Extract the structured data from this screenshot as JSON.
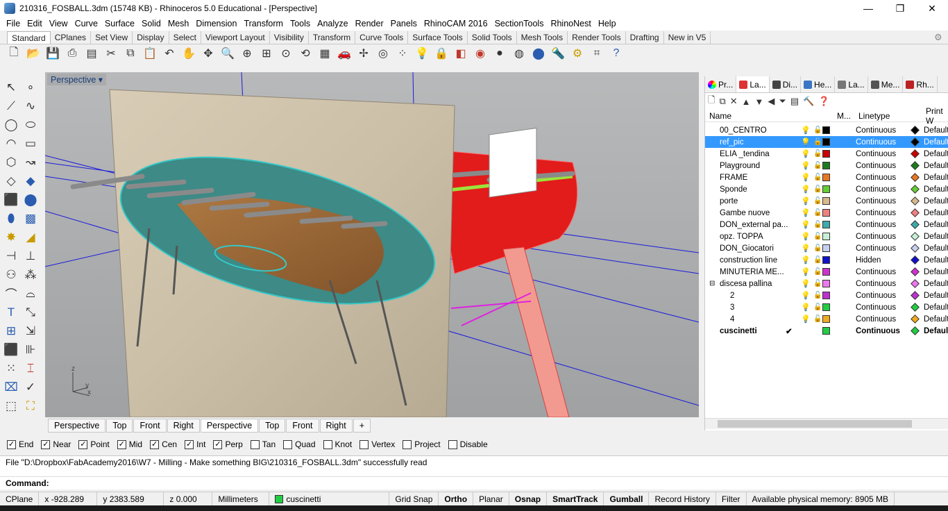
{
  "window": {
    "title": "210316_FOSBALL.3dm (15748 KB) - Rhinoceros 5.0 Educational - [Perspective]"
  },
  "menu": [
    "File",
    "Edit",
    "View",
    "Curve",
    "Surface",
    "Solid",
    "Mesh",
    "Dimension",
    "Transform",
    "Tools",
    "Analyze",
    "Render",
    "Panels",
    "RhinoCAM 2016",
    "SectionTools",
    "RhinoNest",
    "Help"
  ],
  "toolbar_tabs": [
    "Standard",
    "CPlanes",
    "Set View",
    "Display",
    "Select",
    "Viewport Layout",
    "Visibility",
    "Transform",
    "Curve Tools",
    "Surface Tools",
    "Solid Tools",
    "Mesh Tools",
    "Render Tools",
    "Drafting",
    "New in V5"
  ],
  "viewport": {
    "label": "Perspective",
    "axes": {
      "x": "x",
      "y": "y",
      "z": "z"
    }
  },
  "viewport_tabs": [
    "Perspective",
    "Top",
    "Front",
    "Right",
    "Perspective",
    "Top",
    "Front",
    "Right"
  ],
  "osnaps": [
    {
      "label": "End",
      "checked": true
    },
    {
      "label": "Near",
      "checked": true
    },
    {
      "label": "Point",
      "checked": true
    },
    {
      "label": "Mid",
      "checked": true
    },
    {
      "label": "Cen",
      "checked": true
    },
    {
      "label": "Int",
      "checked": true
    },
    {
      "label": "Perp",
      "checked": true
    },
    {
      "label": "Tan",
      "checked": false
    },
    {
      "label": "Quad",
      "checked": false
    },
    {
      "label": "Knot",
      "checked": false
    },
    {
      "label": "Vertex",
      "checked": false
    },
    {
      "label": "Project",
      "checked": false
    },
    {
      "label": "Disable",
      "checked": false
    }
  ],
  "command": {
    "history": "File \"D:\\Dropbox\\FabAcademy2016\\W7 - Milling - Make something BIG\\210316_FOSBALL.3dm\" successfully read",
    "prompt": "Command:"
  },
  "status": {
    "cplane": "CPlane",
    "x": "x -928.289",
    "y": "y 2383.589",
    "z": "z 0.000",
    "units": "Millimeters",
    "layer": "cuscinetti",
    "toggles": [
      "Grid Snap",
      "Ortho",
      "Planar",
      "Osnap",
      "SmartTrack",
      "Gumball",
      "Record History",
      "Filter"
    ],
    "bold_toggles": [
      "Ortho",
      "Osnap",
      "SmartTrack",
      "Gumball"
    ],
    "memory": "Available physical memory: 8905 MB"
  },
  "panel": {
    "tabs": [
      "Pr...",
      "La...",
      "Di...",
      "He...",
      "La...",
      "Me...",
      "Rh..."
    ],
    "columns": [
      "Name",
      "M...",
      "Linetype",
      "Print W"
    ],
    "layers": [
      {
        "name": "00_CENTRO",
        "color": "#000000",
        "linetype": "Continuous",
        "print": "Default"
      },
      {
        "name": "ref_pic",
        "color": "#000000",
        "linetype": "Continuous",
        "print": "Default",
        "selected": true
      },
      {
        "name": "ELIA _tendina",
        "color": "#cc0000",
        "linetype": "Continuous",
        "print": "Default"
      },
      {
        "name": "Playground",
        "color": "#1e7a1e",
        "linetype": "Continuous",
        "print": "Default"
      },
      {
        "name": "FRAME",
        "color": "#e87722",
        "linetype": "Continuous",
        "print": "Default"
      },
      {
        "name": "Sponde",
        "color": "#66cc33",
        "linetype": "Continuous",
        "print": "Default"
      },
      {
        "name": "porte",
        "color": "#d9b98c",
        "linetype": "Continuous",
        "print": "Default"
      },
      {
        "name": "Gambe nuove",
        "color": "#f08080",
        "linetype": "Continuous",
        "print": "Default"
      },
      {
        "name": "DON_external pa...",
        "color": "#3fa9a9",
        "linetype": "Continuous",
        "print": "Default"
      },
      {
        "name": "opz. TOPPA",
        "color": "#c8f0d8",
        "linetype": "Continuous",
        "print": "Default"
      },
      {
        "name": "DON_Giocatori",
        "color": "#c8d0f0",
        "linetype": "Continuous",
        "print": "Default"
      },
      {
        "name": "construction line",
        "color": "#1010cc",
        "linetype": "Hidden",
        "print": "Default"
      },
      {
        "name": "MINUTERIA ME...",
        "color": "#cc33cc",
        "linetype": "Continuous",
        "print": "Default"
      },
      {
        "name": "discesa pallina",
        "color": "#ee77ee",
        "linetype": "Continuous",
        "print": "Default",
        "expander": "⊟"
      },
      {
        "name": "2",
        "color": "#bb33cc",
        "linetype": "Continuous",
        "print": "Default",
        "indent": true
      },
      {
        "name": "3",
        "color": "#22cc44",
        "linetype": "Continuous",
        "print": "Default",
        "indent": true
      },
      {
        "name": "4",
        "color": "#eeaa22",
        "linetype": "Continuous",
        "print": "Default",
        "indent": true
      },
      {
        "name": "cuscinetti",
        "color": "#22cc44",
        "linetype": "Continuous",
        "print": "Default",
        "current": true,
        "check": "✔"
      }
    ]
  }
}
